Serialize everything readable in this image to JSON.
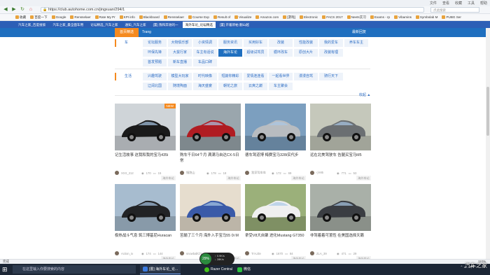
{
  "browser": {
    "title_menu": [
      "文件",
      "查看",
      "收藏",
      "工具",
      "帮助"
    ],
    "url": "https://club.autohome.com.cn/jingxuan/294/1",
    "search_placeholder": "点此搜索",
    "bookmarks": [
      "收藏",
      "百度一下",
      "Google",
      "Rensselaer",
      "Rate My Pr",
      "KPI info",
      "Blackboard",
      "Rensselaer",
      "Course Exp",
      "Result of",
      "Visualize",
      "Amazon.com",
      "[游戏]",
      "Electronic",
      "FACS 2017",
      "Neets实习",
      "Exams - rp",
      "Vibamins",
      "Symbolab M",
      "PUBG Ser"
    ],
    "tabs": [
      "汽车之家_百度搜索",
      "汽车之家_最全面车用",
      "论坛精选_汽车之家",
      "通知_汽车之家",
      "[置] 我和奔驰的一",
      "海外车论_论坛精选",
      "[置] 开着新帕 翻山越"
    ],
    "active_tab_index": 5
  },
  "site": {
    "home_label": "首页精选",
    "ctx_label": "Trang",
    "right_label": "最新回复"
  },
  "filters": [
    {
      "title": "车",
      "chips": [
        "论坛服务",
        "大物俱乐部",
        "小资情调",
        "服务资讯",
        "买用好车",
        "改装",
        "性能改装",
        "我的爱车",
        "养车车主"
      ]
    },
    {
      "title": "",
      "chips": [
        "环保先锋",
        "大拔行家",
        "车主有话说",
        "海外车论",
        "超级试驾员",
        "循环改车",
        "原创大片",
        "改装有理",
        ""
      ]
    },
    {
      "title": "",
      "chips": [
        "首发预题",
        "新车直播",
        "车品口碑",
        "",
        "",
        "",
        "",
        "",
        ""
      ]
    },
    {
      "title": "生活",
      "chips": [
        "兴趣驾驶",
        "模型大玩家",
        "时代映像",
        "短篇你精彩",
        "爱情连连看",
        "一起看世界",
        "漫漫自驾",
        "骑行天下",
        ""
      ]
    },
    {
      "title": "",
      "chips": [
        "辽阔北国",
        "随境陶面",
        "海天盛宴",
        "朝花之旅",
        "云爽之巅",
        "车主聚会",
        "",
        "",
        ""
      ]
    }
  ],
  "selected_chip": "海外车论",
  "collapse_label": "收起 ▲",
  "posts": [
    {
      "title": "记生活故事 这我和我的宝马435i",
      "user": "XXX_212",
      "views": "170",
      "replies": "15",
      "forum": "海外车论",
      "new": true,
      "car_color": "#1a1a1a",
      "bg": "#cfd4d8"
    },
    {
      "title": "购车千日64个月 满满马自达CX-5日常",
      "user": "慢跑山",
      "views": "178",
      "replies": "18",
      "forum": "海外车论",
      "new": false,
      "car_color": "#b01c22",
      "bg": "#9aa6ad"
    },
    {
      "title": "德车驾道博 梅赛宝马328i实代步",
      "user": "我家驾车车",
      "views": "172",
      "replies": "69",
      "forum": "海外车论",
      "new": false,
      "car_color": "#b8bcc0",
      "bg": "#7c9fbf"
    },
    {
      "title": "远在北美驾驶车 告腿买宝马M5",
      "user": "小M5",
      "views": "771",
      "replies": "53",
      "forum": "海外车论",
      "new": false,
      "car_color": "#6b6f72",
      "bg": "#c5c8bb"
    },
    {
      "title": "极热战斗气息 筑三博基尼Huracan",
      "user": "Action_Ix",
      "views": "174",
      "replies": "144",
      "forum": "海外车论",
      "new": false,
      "car_color": "#222325",
      "bg": "#a7bccf"
    },
    {
      "title": "苦输了三个月 海外入手宝马55 0i M",
      "user": "snowballChi",
      "views": "3425",
      "replies": "461",
      "forum": "海外车论",
      "new": false,
      "car_color": "#3a5aa8",
      "bg": "#e6ddce"
    },
    {
      "title": "拿受V8大自聚 进化Mustang GT350",
      "user": "Tri-Litle",
      "views": "1670",
      "replies": "84",
      "forum": "海外车论",
      "new": false,
      "car_color": "#f0f0f0",
      "bg": "#9bb07a"
    },
    {
      "title": "非驾着着可置性 在美国选择天籁",
      "user": "ZLA_39",
      "views": "471",
      "replies": "29",
      "forum": "海外车论",
      "new": false,
      "car_color": "#3a3d42",
      "bg": "#a9b0a8"
    }
  ],
  "status": {
    "left": "完成",
    "zoom": "110%"
  },
  "taskbar": {
    "search_placeholder": "在这里输入你要搜索的内容",
    "tasks": [
      "[置] 海外车论_论...",
      "Razer Central",
      "微信"
    ],
    "net_percent": "29%",
    "net_up": "↑ 0.9K/s",
    "net_down": "↓ 28K/s",
    "watermark": "汽车之家"
  }
}
